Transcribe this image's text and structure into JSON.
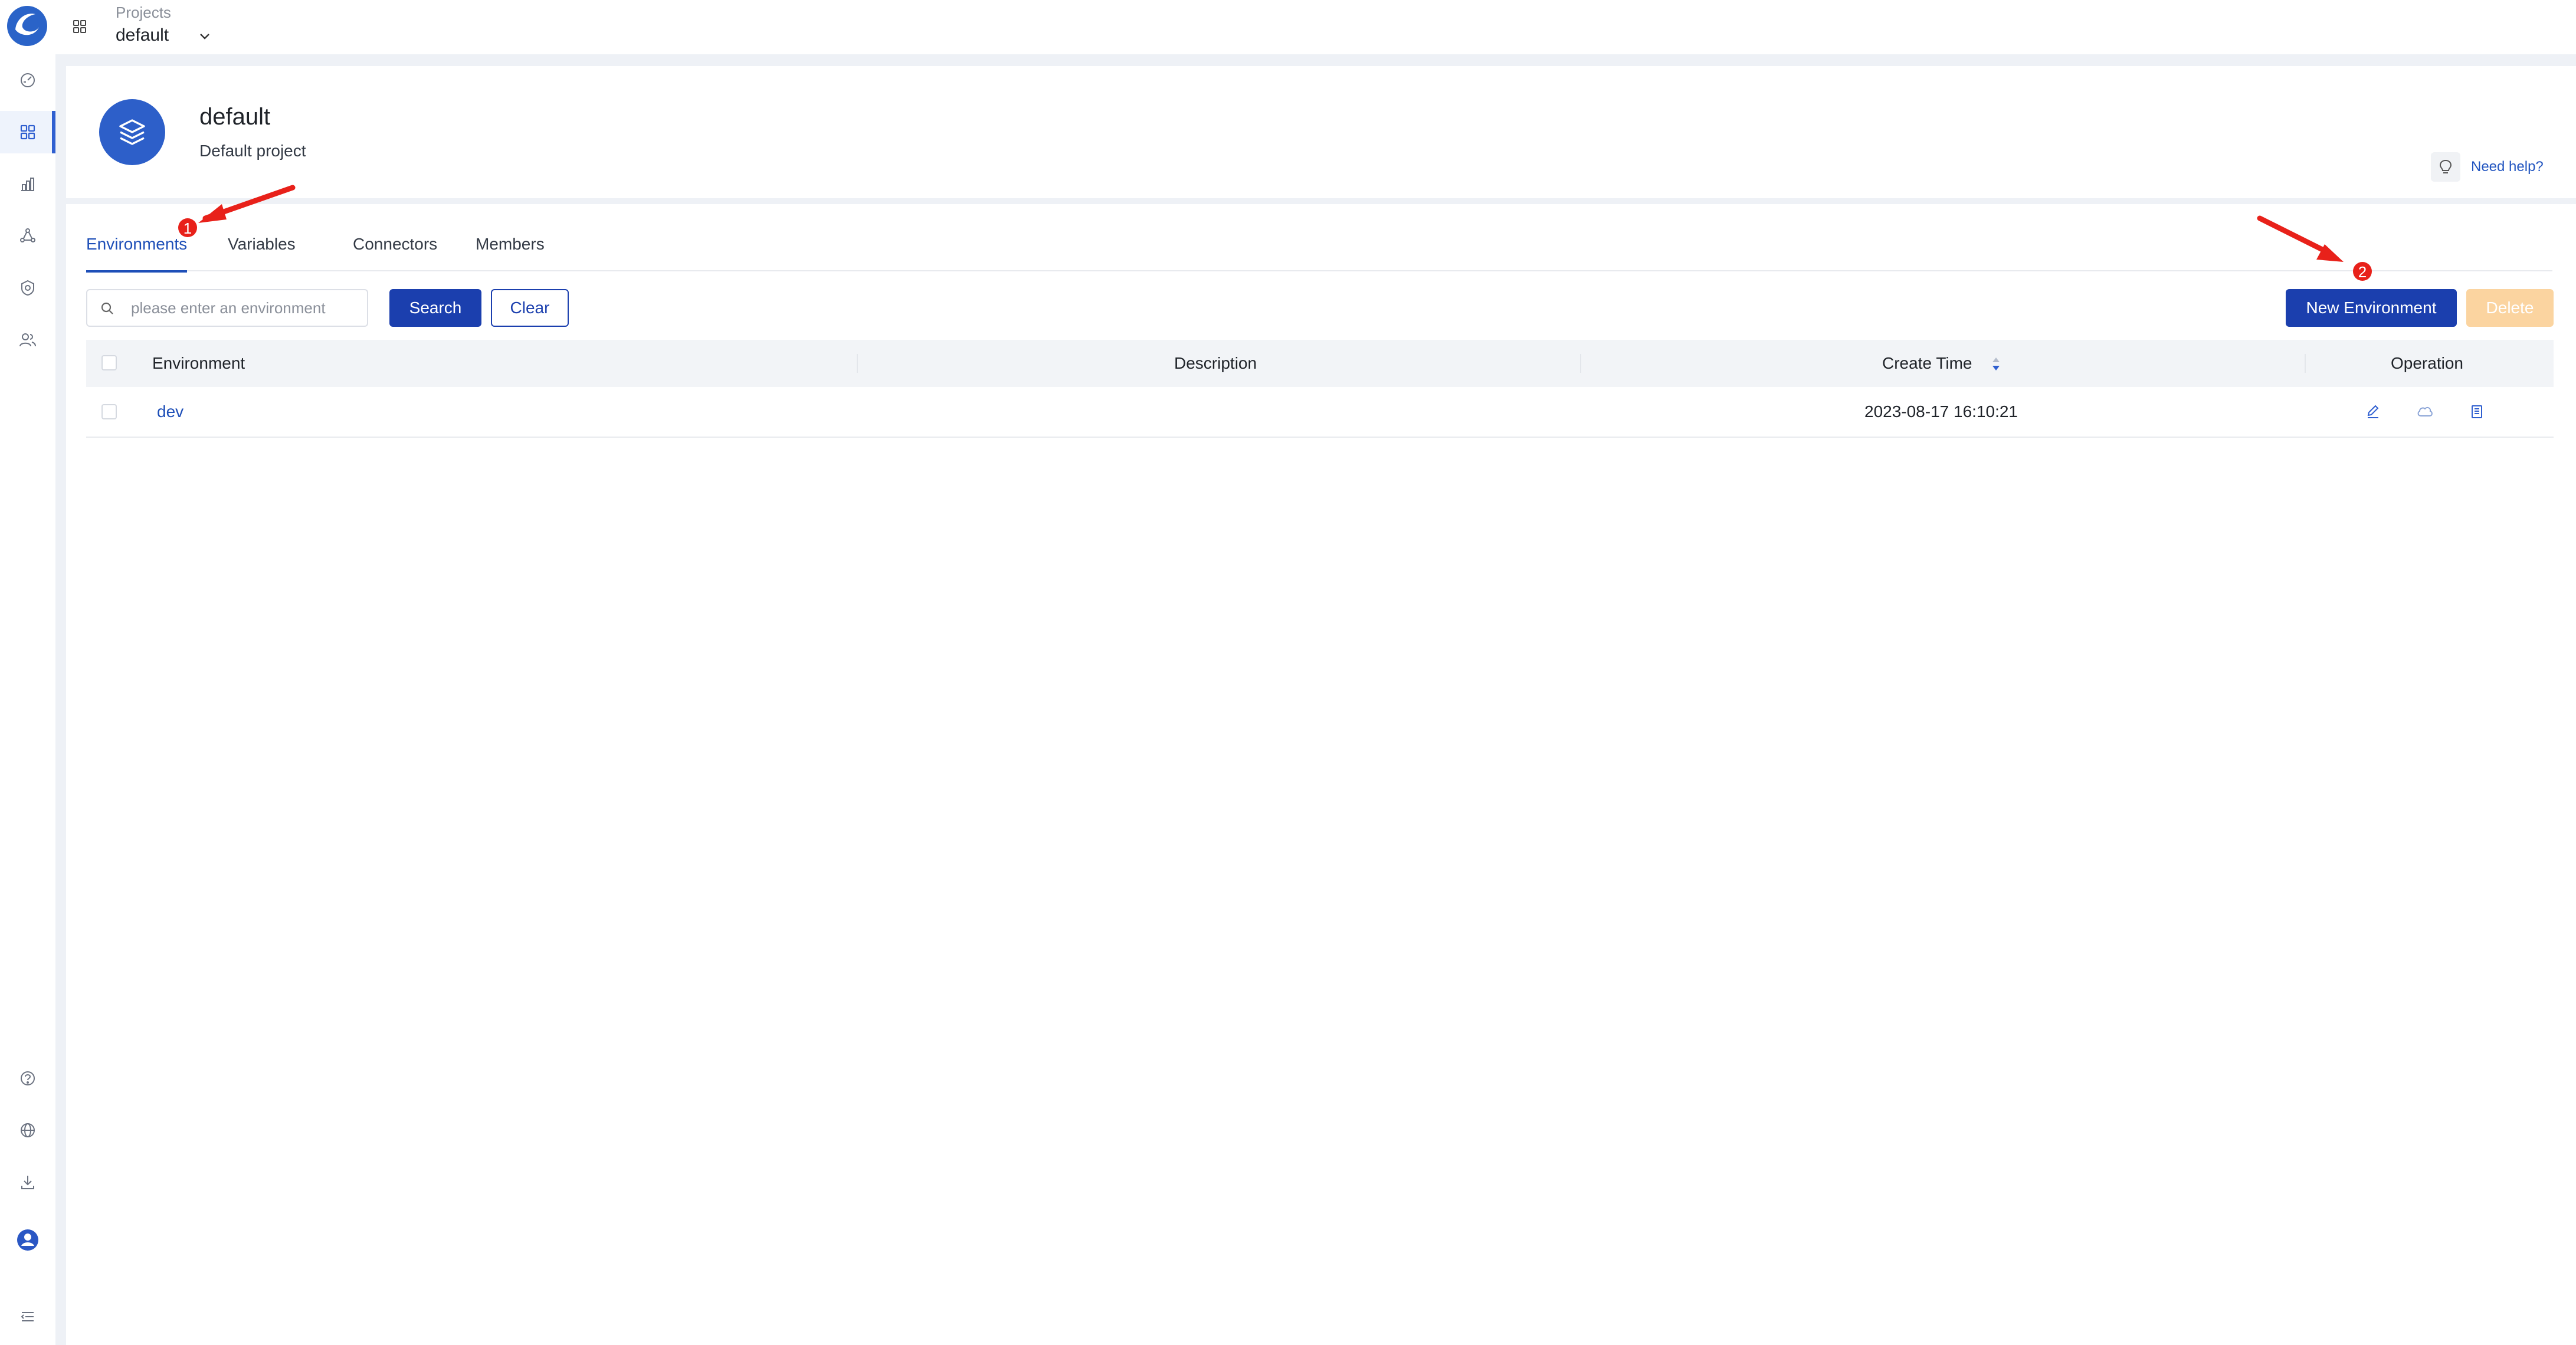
{
  "topbar": {
    "projects_label": "Projects",
    "current_project": "default"
  },
  "sidebar": {
    "items": [
      {
        "icon": "dashboard-icon"
      },
      {
        "icon": "projects-grid-icon",
        "active": true
      },
      {
        "icon": "resources-chart-icon"
      },
      {
        "icon": "data-quality-icon"
      },
      {
        "icon": "security-settings-icon"
      },
      {
        "icon": "users-icon"
      }
    ],
    "bottom_items": [
      {
        "icon": "help-icon"
      },
      {
        "icon": "language-globe-icon"
      },
      {
        "icon": "download-icon"
      },
      {
        "icon": "user-avatar-icon"
      },
      {
        "icon": "collapse-menu-icon"
      }
    ]
  },
  "header": {
    "title": "default",
    "description": "Default project",
    "help_label": "Need help?"
  },
  "tabs": [
    "Environments",
    "Variables",
    "Connectors",
    "Members"
  ],
  "active_tab": "Environments",
  "toolbar": {
    "search_placeholder": "please enter an environment",
    "search_value": "",
    "search_label": "Search",
    "clear_label": "Clear",
    "new_label": "New Environment",
    "delete_label": "Delete"
  },
  "table": {
    "columns": [
      "Environment",
      "Description",
      "Create Time",
      "Operation"
    ],
    "rows": [
      {
        "environment": "dev",
        "description": "",
        "create_time": "2023-08-17 16:10:21"
      }
    ]
  },
  "annotations": [
    "1",
    "2"
  ],
  "colors": {
    "primary": "#1b3fae",
    "link": "#1e4fb8",
    "delete_disabled": "#fbd4a0",
    "annotation": "#e8211a"
  }
}
